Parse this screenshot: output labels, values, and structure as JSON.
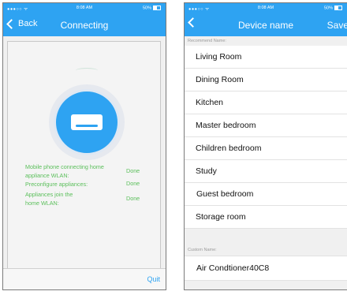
{
  "status_bar": {
    "carrier": "●●●○○ ᯤ",
    "time": "8:08 AM",
    "battery": "50%"
  },
  "connecting_screen": {
    "back_label": "Back",
    "title": "Connecting",
    "steps": [
      {
        "label": "Mobile phone connecting home appliance WLAN:",
        "status": "Done"
      },
      {
        "label": "Preconfigure appliances:",
        "status": "Done"
      },
      {
        "label": "Appliances join the home WLAN:",
        "status": "Done"
      }
    ],
    "quit_label": "Quit",
    "accent_color": "#2ea3f2",
    "status_color": "#5bbf5b"
  },
  "device_name_screen": {
    "title": "Device name",
    "save_label": "Save",
    "recommend_label": "Recommend Name:",
    "recommended_names": [
      "Living Room",
      "Dining Room",
      "Kitchen",
      "Master bedroom",
      "Children bedroom",
      "Study",
      "Guest bedroom",
      "Storage room"
    ],
    "custom_label": "Custom Name:",
    "custom_name": "Air Condtioner40C8"
  }
}
